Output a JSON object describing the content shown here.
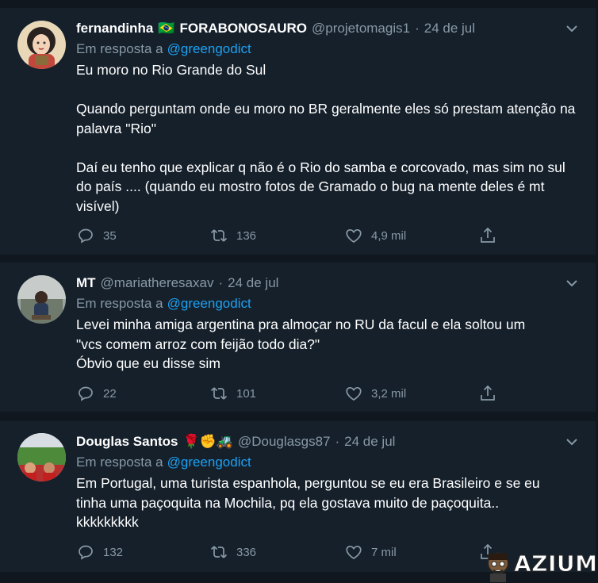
{
  "tweets": [
    {
      "name": "fernandinha",
      "emoji": "🇧🇷",
      "display_suffix": "FORABONOSAURO",
      "handle": "@projetomagis1",
      "separator": "·",
      "date": "24 de jul",
      "reply_prefix": "Em resposta a",
      "reply_to": "@greengodict",
      "paragraphs": [
        "Eu moro no Rio Grande do Sul",
        "Quando perguntam onde eu moro no BR geralmente eles só prestam atenção na palavra \"Rio\"",
        "Daí eu tenho que explicar q não é o Rio do samba e corcovado, mas sim no sul do país .... (quando eu mostro fotos de Gramado o bug na mente deles é mt visível)"
      ],
      "replies": "35",
      "retweets": "136",
      "likes": "4,9 mil"
    },
    {
      "name": "MT",
      "handle": "@mariatheresaxav",
      "separator": "·",
      "date": "24 de jul",
      "reply_prefix": "Em resposta a",
      "reply_to": "@greengodict",
      "lines": [
        "Levei minha amiga argentina pra almoçar no RU da facul e ela soltou um",
        "\"vcs comem arroz com feijão todo dia?\"",
        "Óbvio que eu disse sim"
      ],
      "replies": "22",
      "retweets": "101",
      "likes": "3,2 mil"
    },
    {
      "name": "Douglas Santos",
      "emojis": "🌹✊🚜",
      "handle": "@Douglasgs87",
      "separator": "·",
      "date": "24 de jul",
      "reply_prefix": "Em resposta a",
      "reply_to": "@greengodict",
      "lines": [
        "Em Portugal, uma turista espanhola, perguntou se eu era Brasileiro e se eu",
        "tinha uma paçoquita na Mochila, pq ela gostava muito de paçoquita..",
        "kkkkkkkkk"
      ],
      "replies": "132",
      "retweets": "336",
      "likes": "7 mil"
    }
  ],
  "watermark": "AZIUME",
  "colors": {
    "background": "#15202b",
    "divider": "#10171e",
    "secondary_text": "#8899a6",
    "link": "#1da1f2"
  }
}
